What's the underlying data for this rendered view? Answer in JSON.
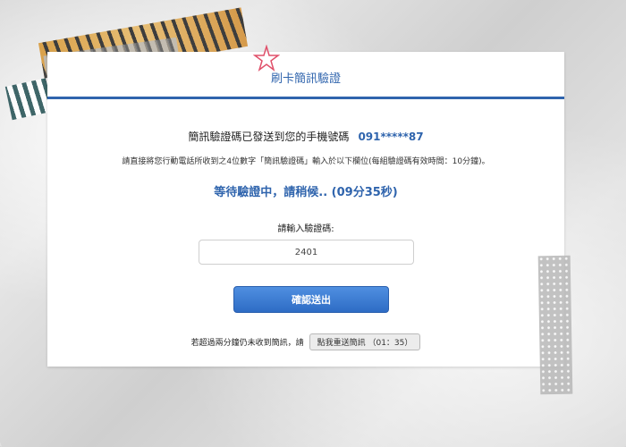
{
  "header": {
    "title": "刷卡簡訊驗證"
  },
  "message": {
    "sent_text": "簡訊驗證碼已發送到您的手機號碼",
    "phone": "091*****87",
    "instruction": "請直接將您行動電話所收到之4位數字「簡訊驗證碼」輸入於以下欄位(每組驗證碼有效時間：10分鐘)。",
    "waiting": "等待驗證中，請稍候.. (09分35秒)"
  },
  "form": {
    "label": "請輸入驗證碼:",
    "code_value": "2401",
    "submit_label": "確認送出"
  },
  "resend": {
    "prompt": "若超過兩分鐘仍未收到簡訊，請",
    "button_label": "點我重送簡訊  （01：35）"
  },
  "colors": {
    "accent": "#2f64ad"
  }
}
